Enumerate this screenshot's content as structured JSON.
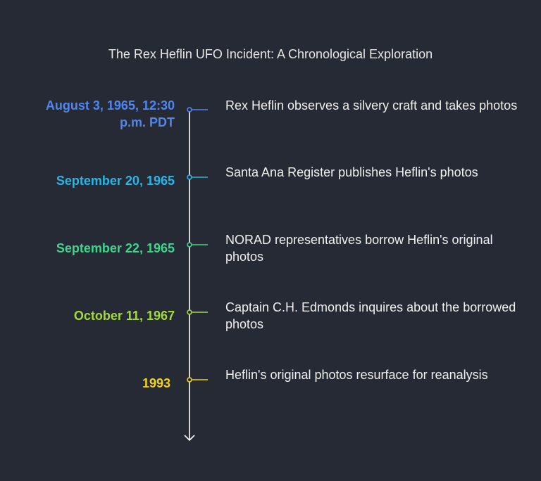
{
  "title": "The Rex Heflin UFO Incident: A Chronological Exploration",
  "events": [
    {
      "date": "August 3, 1965, 12:30 p.m. PDT",
      "text": "Rex Heflin observes a silvery craft and takes photos",
      "color": "#4f86f0"
    },
    {
      "date": "September 20, 1965",
      "text": "Santa Ana Register publishes Heflin's photos",
      "color": "#29b6e6"
    },
    {
      "date": "September 22, 1965",
      "text": "NORAD representatives borrow Heflin's original photos",
      "color": "#3dd68c"
    },
    {
      "date": "October 11, 1967",
      "text": "Captain C.H. Edmonds inquires about the borrowed photos",
      "color": "#a3d93b"
    },
    {
      "date": "1993",
      "text": "Heflin's original photos resurface for reanalysis",
      "color": "#f2d21b"
    }
  ],
  "axis_color": "#ffffff"
}
